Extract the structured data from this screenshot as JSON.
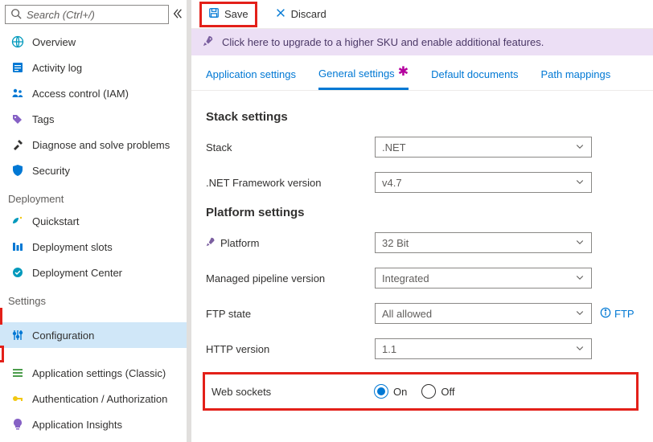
{
  "search": {
    "placeholder": "Search (Ctrl+/)"
  },
  "sidebar": {
    "items": [
      {
        "label": "Overview"
      },
      {
        "label": "Activity log"
      },
      {
        "label": "Access control (IAM)"
      },
      {
        "label": "Tags"
      },
      {
        "label": "Diagnose and solve problems"
      },
      {
        "label": "Security"
      }
    ],
    "section_deployment": "Deployment",
    "deployment": [
      {
        "label": "Quickstart"
      },
      {
        "label": "Deployment slots"
      },
      {
        "label": "Deployment Center"
      }
    ],
    "section_settings": "Settings",
    "settings": [
      {
        "label": "Configuration"
      },
      {
        "label": "Application settings (Classic)"
      },
      {
        "label": "Authentication / Authorization"
      },
      {
        "label": "Application Insights"
      }
    ]
  },
  "toolbar": {
    "save_label": "Save",
    "discard_label": "Discard"
  },
  "banner": {
    "text": "Click here to upgrade to a higher SKU and enable additional features."
  },
  "tabs": [
    {
      "label": "Application settings"
    },
    {
      "label": "General settings"
    },
    {
      "label": "Default documents"
    },
    {
      "label": "Path mappings"
    }
  ],
  "sections": {
    "stack": {
      "title": "Stack settings",
      "rows": {
        "stack": {
          "label": "Stack",
          "value": ".NET"
        },
        "framework": {
          "label": ".NET Framework version",
          "value": "v4.7"
        }
      }
    },
    "platform": {
      "title": "Platform settings",
      "rows": {
        "platform": {
          "label": "Platform",
          "value": "32 Bit"
        },
        "pipeline": {
          "label": "Managed pipeline version",
          "value": "Integrated"
        },
        "ftp": {
          "label": "FTP state",
          "value": "All allowed",
          "info_label": "FTP"
        },
        "http": {
          "label": "HTTP version",
          "value": "1.1"
        },
        "websockets": {
          "label": "Web sockets",
          "on": "On",
          "off": "Off",
          "selected": "On"
        }
      }
    }
  }
}
